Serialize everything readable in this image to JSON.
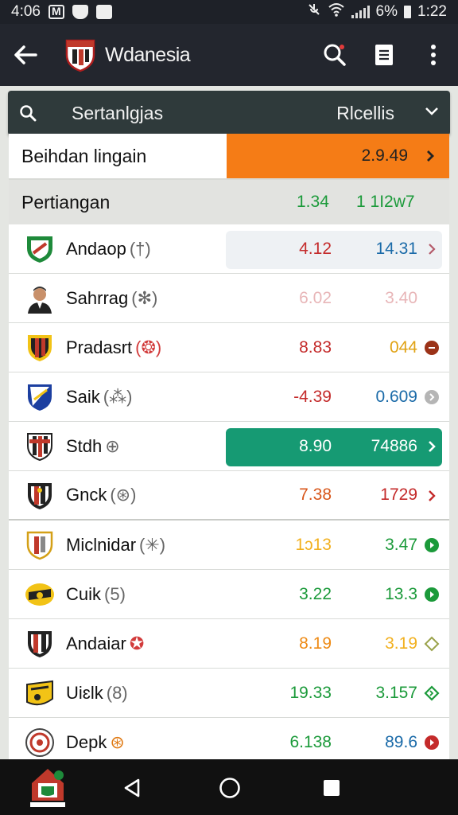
{
  "status": {
    "time_left": "4:06",
    "battery": "6%",
    "clock": "1:22"
  },
  "app": {
    "title": "Wdanesia"
  },
  "search": {
    "text": "Sertanlgjas",
    "filter": "Rlcellis"
  },
  "highlight": {
    "label": "Beihdan lingain",
    "odds": "2.9.49"
  },
  "header": {
    "label": "Pertiangan",
    "col1": "1.34",
    "col2": "1   1I2w7"
  },
  "rows": [
    {
      "name": "Andaop",
      "tag": "(†)",
      "odd1": "4.12",
      "odd2": "14.31",
      "odd1_color": "#c42a2a",
      "odd2_color": "#1a6aa8"
    },
    {
      "name": "Sahrrag",
      "tag": "(✻)",
      "odd1": "6.02",
      "odd2": "3.40",
      "odd1_color": "#e8b6b8",
      "odd2_color": "#e8b6b8"
    },
    {
      "name": "Pradasrt",
      "tag": "(❂)",
      "odd1": "8.83",
      "odd2": "044",
      "odd1_color": "#c42a2a",
      "odd2_color": "#e0a214"
    },
    {
      "name": "Saik",
      "tag": "(⁂)",
      "odd1": "-4.39",
      "odd2": "0.609",
      "odd1_color": "#c42a2a",
      "odd2_color": "#1a6aa8"
    },
    {
      "name": "Stdh",
      "tag": "⊕",
      "odd1": "8.90",
      "odd2": "74886",
      "odd1_color": "#ffffff",
      "odd2_color": "#ffffff"
    },
    {
      "name": "Gnck",
      "tag": "(⊛)",
      "odd1": "7.38",
      "odd2": "1729",
      "odd1_color": "#d8561a",
      "odd2_color": "#c42a2a"
    },
    {
      "name": "Miclnidar",
      "tag": "(✳)",
      "odd1": "1ɔ13",
      "odd2": "3.47",
      "odd1_color": "#f2b01e",
      "odd2_color": "#1b9a3a"
    },
    {
      "name": "Cuik",
      "tag": "(5)",
      "odd1": "3.22",
      "odd2": "13.3",
      "odd1_color": "#1b9a3a",
      "odd2_color": "#1b9a3a"
    },
    {
      "name": "Andaiar",
      "tag": "✪",
      "odd1": "8.19",
      "odd2": "3.19",
      "odd1_color": "#ee8a14",
      "odd2_color": "#f2b01e"
    },
    {
      "name": "Uiɛlk",
      "tag": "(8)",
      "odd1": "19.33",
      "odd2": "3.157",
      "odd1_color": "#1b9a3a",
      "odd2_color": "#1b9a3a"
    },
    {
      "name": "Depk",
      "tag": "⊛",
      "odd1": "6.138",
      "odd2": "89.6",
      "odd1_color": "#1b9a3a",
      "odd2_color": "#1a6aa8"
    }
  ],
  "arrows": [
    {
      "icon": "chevron-right-icon",
      "color": "#b45a6a"
    },
    {
      "icon": "none",
      "color": "#ffffff"
    },
    {
      "icon": "circle-chevron-right-icon",
      "color": "#9b3218"
    },
    {
      "icon": "circle-chevron-right-icon",
      "color": "#aaaaaa"
    },
    {
      "icon": "chevron-right-icon",
      "color": "#ffffff"
    },
    {
      "icon": "chevron-right-icon",
      "color": "#c42a2a"
    },
    {
      "icon": "circle-chevron-right-icon",
      "color": "#1b9a3a"
    },
    {
      "icon": "circle-chevron-right-icon",
      "color": "#1b9a3a"
    },
    {
      "icon": "diamond-icon",
      "color": "#9aa24a"
    },
    {
      "icon": "diamond-icon",
      "color": "#1b9a3a"
    },
    {
      "icon": "circle-chevron-right-icon",
      "color": "#c42a2a"
    }
  ]
}
